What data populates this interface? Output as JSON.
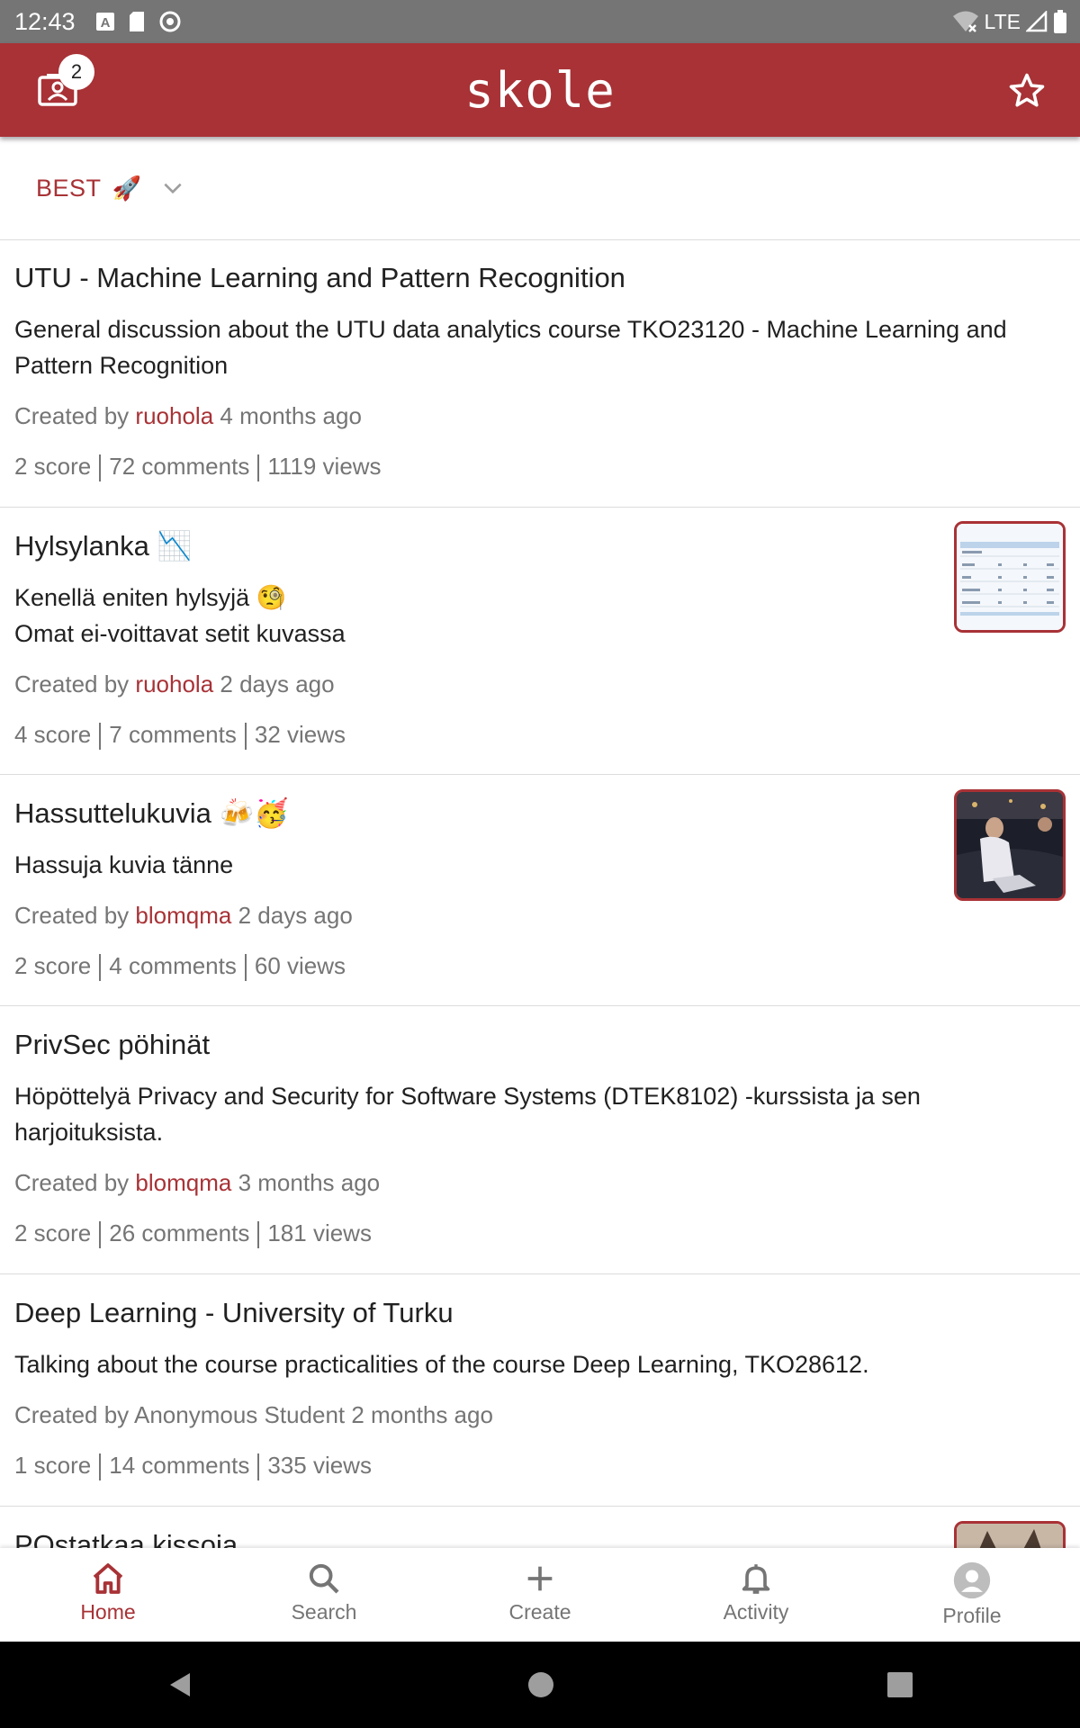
{
  "status": {
    "time": "12:43",
    "network": "LTE"
  },
  "app": {
    "title": "skole",
    "badge_count": "2",
    "brand_color": "#a83236"
  },
  "sort": {
    "label": "BEST",
    "emoji": "🚀"
  },
  "posts": [
    {
      "title": "UTU - Machine Learning and Pattern Recognition",
      "text": "General discussion about the UTU data analytics course TKO23120 - Machine Learning and Pattern Recognition",
      "created_by": "Created by",
      "author": "ruohola",
      "time": "4 months ago",
      "score": "2 score",
      "comments": "72 comments",
      "views": "1119 views"
    },
    {
      "title": "Hylsylanka 📉",
      "text": "Kenellä eniten hylsyjä 🧐\nOmat ei-voittavat setit kuvassa",
      "created_by": "Created by",
      "author": "ruohola",
      "time": "2 days ago",
      "score": "4 score",
      "comments": "7 comments",
      "views": "32 views"
    },
    {
      "title": "Hassuttelukuvia 🍻🥳",
      "text": "Hassuja kuvia tänne",
      "created_by": "Created by",
      "author": "blomqma",
      "time": "2 days ago",
      "score": "2 score",
      "comments": "4 comments",
      "views": "60 views"
    },
    {
      "title": "PrivSec pöhinät",
      "text": "Höpöttelyä Privacy and Security for Software Systems (DTEK8102) -kurssista ja sen harjoituksista.",
      "created_by": "Created by",
      "author": "blomqma",
      "time": "3 months ago",
      "score": "2 score",
      "comments": "26 comments",
      "views": "181 views"
    },
    {
      "title": "Deep Learning - University of Turku",
      "text": "Talking about the course practicalities of the course Deep Learning, TKO28612.",
      "created_by": "Created by",
      "author": "Anonymous Student",
      "time": "2 months ago",
      "score": "1 score",
      "comments": "14 comments",
      "views": "335 views"
    },
    {
      "title": "POstatkaa kissoja"
    }
  ],
  "nav": {
    "home": "Home",
    "search": "Search",
    "create": "Create",
    "activity": "Activity",
    "profile": "Profile"
  }
}
